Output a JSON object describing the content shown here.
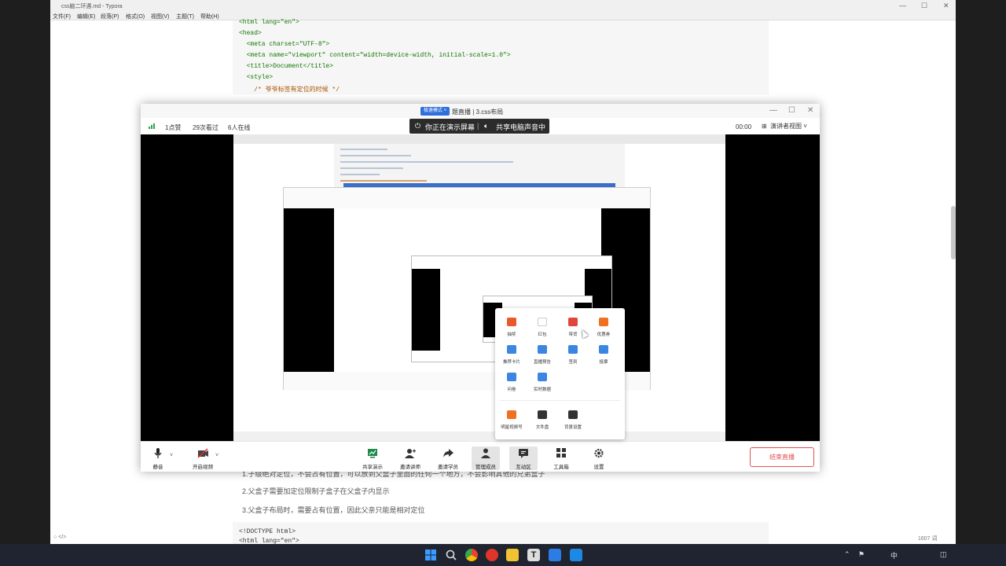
{
  "typora": {
    "window_title": "css脑二环遇.md - Typora",
    "menu": [
      "文件(F)",
      "编辑(E)",
      "段落(P)",
      "格式(O)",
      "视图(V)",
      "主题(T)",
      "帮助(H)"
    ],
    "code_lines": {
      "l1": "<html lang=\"en\">",
      "l2": "<head>",
      "l3": "  <meta charset=\"UTF-8\">",
      "l4": "  <meta name=\"viewport\" content=\"width=device-width, initial-scale=1.0\">",
      "l5": "  <title>Document</title>",
      "l6": "  <style>",
      "l7": "    /* 爷爷标签有定位的时候 */"
    },
    "md_lines": [
      "1.子级绝对定位，不会占有位置，可以放到父盒子里面的任何一个地方，不会影响其他的兄弟盒子",
      "2.父盒子需要加定位限制子盒子在父盒子内显示",
      "3.父盒子布局时，需要占有位置，因此父亲只能是相对定位"
    ],
    "code2_lines": [
      "<!DOCTYPE html>",
      "<html lang=\"en\">"
    ],
    "word_count": "1607 词"
  },
  "live": {
    "mode_badge": "极速模式 ˅",
    "title": "题直播  |  3.css布局",
    "stats": {
      "likes": "1点赞",
      "watched": "29次看过",
      "online": "6人在线"
    },
    "share_banner": {
      "screen": "你正在演示屏幕",
      "audio": "共享电脑声音中"
    },
    "timer": "00:00",
    "view_select": "演讲者视图 ˅",
    "tool_popup": [
      {
        "label": "抽奖",
        "color": "#e85a2c"
      },
      {
        "label": "红包",
        "color": "#ffffff"
      },
      {
        "label": "带货",
        "color": "#e0473a"
      },
      {
        "label": "优惠券",
        "color": "#f07020"
      },
      {
        "label": "推荐卡片",
        "color": "#3a86e0"
      },
      {
        "label": "直播预告",
        "color": "#3a86e0"
      },
      {
        "label": "签到",
        "color": "#3a86e0"
      },
      {
        "label": "投票",
        "color": "#3a86e0"
      },
      {
        "label": "问卷",
        "color": "#3a86e0"
      },
      {
        "label": "实时数据",
        "color": "#3a86e0"
      },
      {
        "label": "明星视频号",
        "color": "#f07020"
      },
      {
        "label": "文件盘",
        "color": "#333333"
      },
      {
        "label": "背景设置",
        "color": "#333333"
      }
    ],
    "toolbar": {
      "mute": "静音",
      "video": "开启视频",
      "share_demo": "共享演示",
      "invite_speaker": "邀请讲师",
      "invite_student": "邀请学员",
      "manage_members": "管理成员",
      "interaction": "互动区",
      "toolbox": "工具箱",
      "settings": "设置",
      "end_live": "结束直播"
    }
  },
  "taskbar": {
    "tray_lang": "中"
  }
}
